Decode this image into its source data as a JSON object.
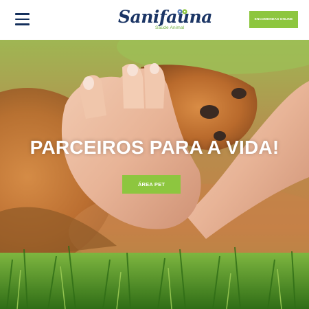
{
  "header": {
    "logo_text": "Sanifauna",
    "logo_tagline": "Saúde Animal",
    "order_button_label": "ENCOMENDAS ONLINE"
  },
  "hero": {
    "title": "PARCEIROS PARA A VIDA!",
    "cta_label": "ÁREA PET"
  },
  "colors": {
    "brand_navy": "#1b3565",
    "accent_green": "#8dc63f",
    "tagline_green": "#6fae3c"
  },
  "icons": {
    "menu": "hamburger-menu-icon"
  }
}
